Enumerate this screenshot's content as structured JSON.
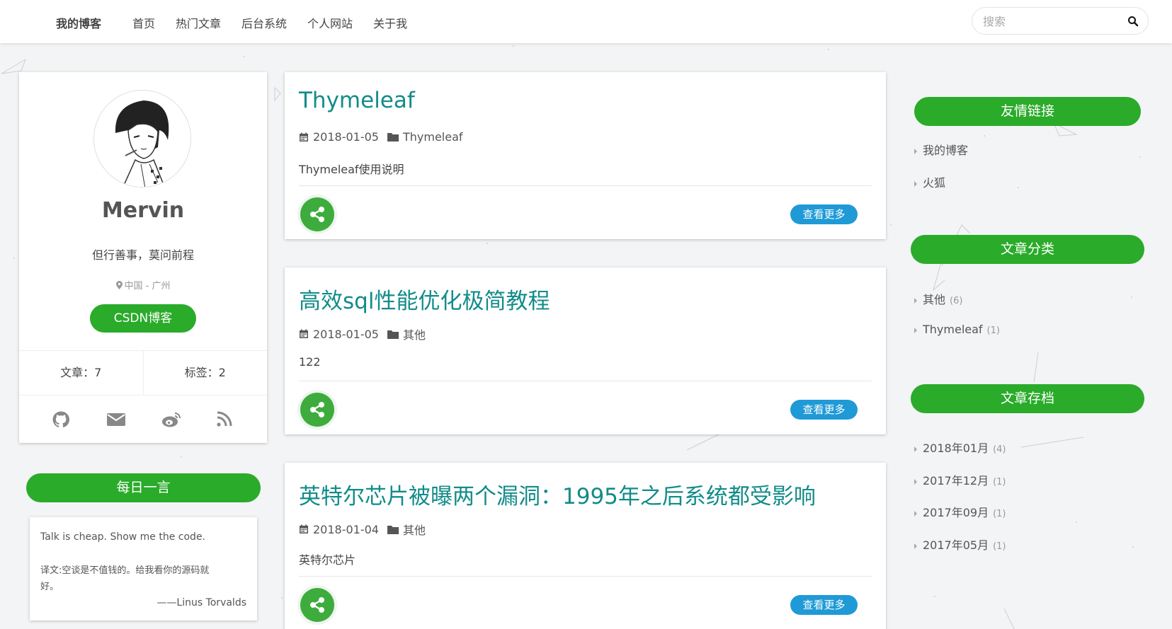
{
  "topbar": {
    "brand": "我的博客",
    "nav": [
      "首页",
      "热门文章",
      "后台系统",
      "个人网站",
      "关于我"
    ],
    "search_placeholder": "搜索"
  },
  "profile": {
    "name": "Mervin",
    "motto": "但行善事，莫问前程",
    "location": "中国 - 广州",
    "csdn_label": "CSDN博客",
    "articles": "文章：7",
    "tags": "标签：2",
    "social_icons": [
      "github-icon",
      "mail-icon",
      "weibo-icon",
      "rss-icon"
    ]
  },
  "daily_quote": {
    "header": "每日一言",
    "text": "Talk is cheap. Show me the code.",
    "translation_line1": "译文:空谈是不值钱的。给我看你的源码就",
    "translation_line2": "好。",
    "author": "——Linus Torvalds"
  },
  "posts": [
    {
      "title": "Thymeleaf",
      "date": "2018-01-05",
      "category": "Thymeleaf",
      "desc": "Thymeleaf使用说明",
      "more": "查看更多"
    },
    {
      "title": "高效sql性能优化极简教程",
      "date": "2018-01-05",
      "category": "其他",
      "desc": "122",
      "more": "查看更多"
    },
    {
      "title": "英特尔芯片被曝两个漏洞：1995年之后系统都受影响",
      "date": "2018-01-04",
      "category": "其他",
      "desc": "英特尔芯片",
      "more": "查看更多"
    }
  ],
  "sidebar": {
    "links_header": "友情链接",
    "links": [
      "我的博客",
      "火狐"
    ],
    "categories_header": "文章分类",
    "categories": [
      {
        "name": "其他",
        "count": "(6)"
      },
      {
        "name": "Thymeleaf",
        "count": "(1)"
      }
    ],
    "archive_header": "文章存档",
    "archive": [
      {
        "name": "2018年01月",
        "count": "(4)"
      },
      {
        "name": "2017年12月",
        "count": "(1)"
      },
      {
        "name": "2017年09月",
        "count": "(1)"
      },
      {
        "name": "2017年05月",
        "count": "(1)"
      }
    ]
  },
  "colors": {
    "accent_green": "#2aab2a",
    "title_teal": "#128c89",
    "more_blue": "#1f9ad6"
  }
}
